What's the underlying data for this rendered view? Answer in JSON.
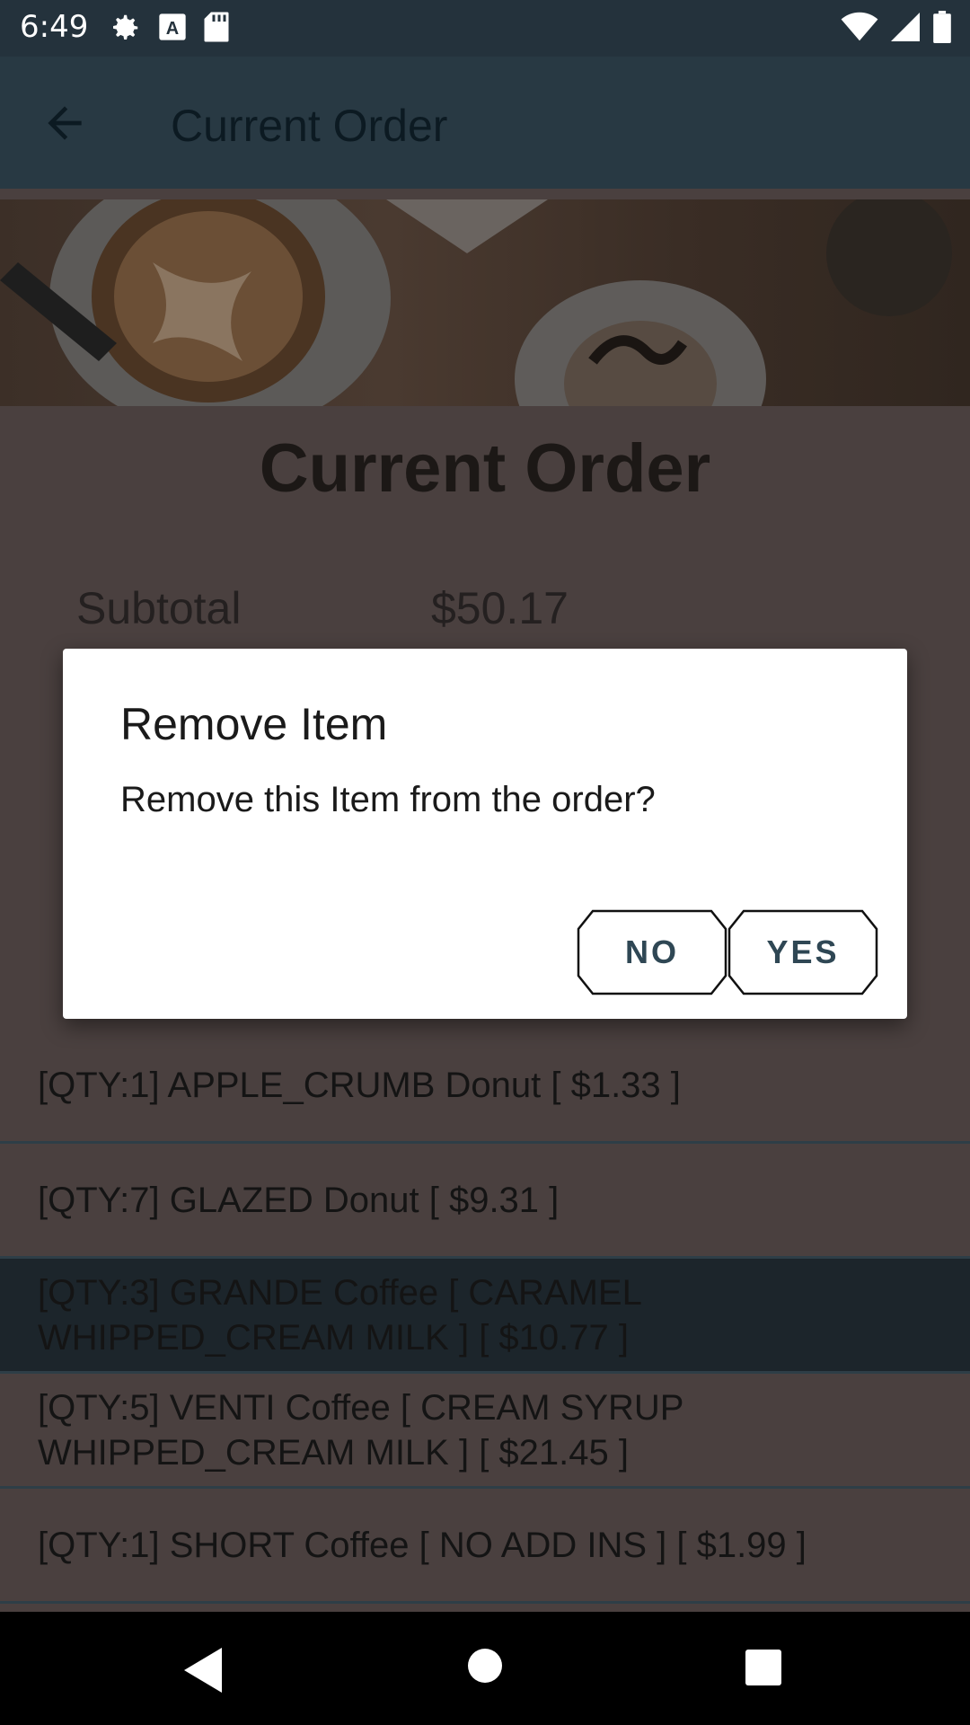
{
  "status_bar": {
    "time": "6:49",
    "icons_left": [
      "settings-icon",
      "text-icon",
      "sd-card-icon"
    ],
    "icons_right": [
      "wifi-icon",
      "signal-icon",
      "battery-icon"
    ]
  },
  "app_bar": {
    "title": "Current Order",
    "back_icon": "arrow-back-icon"
  },
  "page": {
    "heading": "Current Order",
    "subtotal_label": "Subtotal",
    "subtotal_value": "$50.17"
  },
  "order_items": [
    {
      "text": "[QTY:1] APPLE_CRUMB Donut [ $1.33 ]",
      "selected": false
    },
    {
      "text": "[QTY:7] GLAZED Donut [ $9.31 ]",
      "selected": false
    },
    {
      "text": "[QTY:3] GRANDE Coffee [ CARAMEL WHIPPED_CREAM MILK ] [ $10.77 ]",
      "selected": true
    },
    {
      "text": "[QTY:5] VENTI Coffee [ CREAM SYRUP WHIPPED_CREAM MILK ] [ $21.45 ]",
      "selected": false
    },
    {
      "text": "[QTY:1] SHORT Coffee [ NO ADD INS ]  [ $1.99 ]",
      "selected": false
    }
  ],
  "dialog": {
    "title": "Remove Item",
    "message": "Remove this Item from the order?",
    "no_label": "NO",
    "yes_label": "YES"
  },
  "colors": {
    "status_bar": "#24323c",
    "app_bar": "#283943",
    "dim_content": "#4a403f",
    "selected_row": "#1c252b",
    "button_text": "#2f4754"
  }
}
